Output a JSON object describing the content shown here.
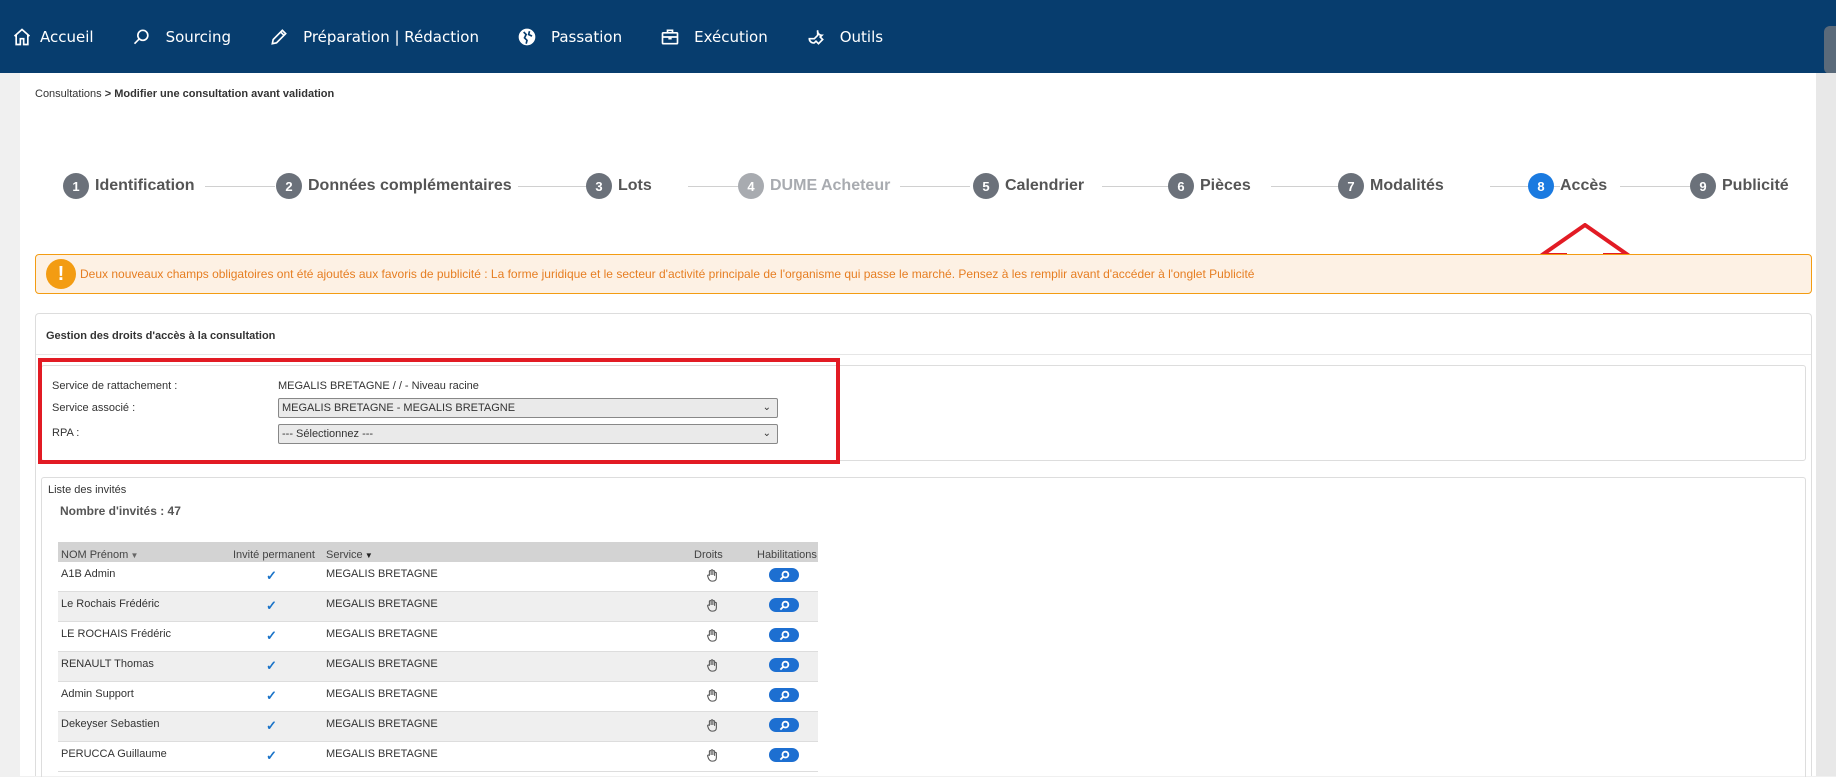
{
  "nav": {
    "items": [
      {
        "label": "Accueil",
        "icon": "home-icon"
      },
      {
        "label": "Sourcing",
        "icon": "search-icon"
      },
      {
        "label": "Préparation | Rédaction",
        "icon": "pencil-icon"
      },
      {
        "label": "Passation",
        "icon": "globe-icon"
      },
      {
        "label": "Exécution",
        "icon": "briefcase-icon"
      },
      {
        "label": "Outils",
        "icon": "wrench-icon"
      }
    ]
  },
  "breadcrumb": {
    "root": "Consultations",
    "sep": " > ",
    "current": "Modifier une consultation avant validation"
  },
  "steps": [
    {
      "num": "1",
      "label": "Identification",
      "state": "normal"
    },
    {
      "num": "2",
      "label": "Données complémentaires",
      "state": "normal"
    },
    {
      "num": "3",
      "label": "Lots",
      "state": "normal"
    },
    {
      "num": "4",
      "label": "DUME Acheteur",
      "state": "disabled"
    },
    {
      "num": "5",
      "label": "Calendrier",
      "state": "normal"
    },
    {
      "num": "6",
      "label": "Pièces",
      "state": "normal"
    },
    {
      "num": "7",
      "label": "Modalités",
      "state": "normal"
    },
    {
      "num": "8",
      "label": "Accès",
      "state": "active"
    },
    {
      "num": "9",
      "label": "Publicité",
      "state": "normal"
    }
  ],
  "warning": {
    "icon": "!",
    "text": "Deux nouveaux champs obligatoires ont été ajoutés aux favoris de publicité : La forme juridique et le secteur d'activité principale de l'organisme qui passe le marché. Pensez à les remplir avant d'accéder à l'onglet Publicité"
  },
  "section": {
    "title": "Gestion des droits d'accès à la consultation",
    "service_rattachement_label": "Service de rattachement :",
    "service_rattachement_value": "MEGALIS BRETAGNE / / - Niveau racine",
    "service_associe_label": "Service associé :",
    "service_associe_value": "MEGALIS BRETAGNE - MEGALIS BRETAGNE",
    "rpa_label": "RPA :",
    "rpa_value": "--- Sélectionnez ---"
  },
  "invites": {
    "title": "Liste des invités",
    "count_text": "Nombre d'invités : 47",
    "columns": {
      "name": "NOM Prénom",
      "permanent": "Invité permanent",
      "service": "Service",
      "droits": "Droits",
      "habilitations": "Habilitations"
    },
    "rows": [
      {
        "name": "A1B Admin",
        "service": "MEGALIS BRETAGNE"
      },
      {
        "name": "Le Rochais Frédéric",
        "service": "MEGALIS BRETAGNE"
      },
      {
        "name": "LE ROCHAIS Frédéric",
        "service": "MEGALIS BRETAGNE"
      },
      {
        "name": "RENAULT Thomas",
        "service": "MEGALIS BRETAGNE"
      },
      {
        "name": "Admin Support",
        "service": "MEGALIS BRETAGNE"
      },
      {
        "name": "Dekeyser Sebastien",
        "service": "MEGALIS BRETAGNE"
      },
      {
        "name": "PERUCCA Guillaume",
        "service": "MEGALIS BRETAGNE"
      }
    ]
  },
  "colors": {
    "nav_bg": "#073d6e",
    "active_step": "#1a7ae0",
    "warning": "#f39c12",
    "highlight_red": "#e21b24"
  }
}
